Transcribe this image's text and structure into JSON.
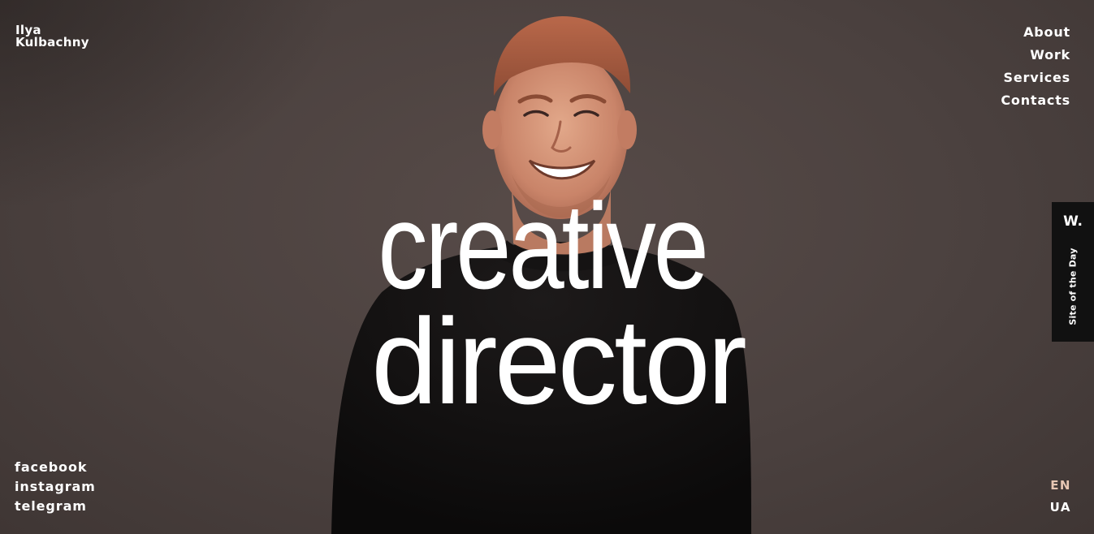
{
  "brand": {
    "line1": "Ilya",
    "line2": "Kulbachny"
  },
  "nav": {
    "items": [
      {
        "label": "About"
      },
      {
        "label": "Work"
      },
      {
        "label": "Services"
      },
      {
        "label": "Contacts"
      }
    ]
  },
  "hero": {
    "line1": "creative",
    "line2": "director"
  },
  "social": {
    "items": [
      {
        "label": "facebook"
      },
      {
        "label": "instagram"
      },
      {
        "label": "telegram"
      }
    ]
  },
  "language": {
    "options": [
      {
        "label": "EN",
        "active": true
      },
      {
        "label": "UA",
        "active": false
      }
    ]
  },
  "ribbon": {
    "mark": "W.",
    "label": "Site of the Day"
  },
  "colors": {
    "background": "#4b413f",
    "text": "#ffffff",
    "active_language": "#e7c6b3",
    "ribbon": "#111111"
  }
}
